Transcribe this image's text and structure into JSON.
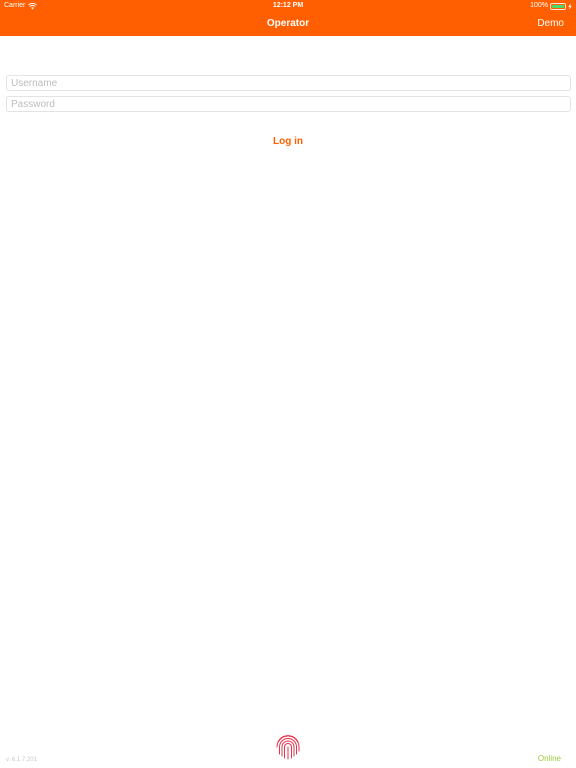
{
  "status_bar": {
    "carrier": "Carrier",
    "time": "12:12 PM",
    "battery": "100%",
    "wifi_icon": "wifi-icon",
    "battery_icon": "battery-icon",
    "charge_icon": "charging-bolt-icon"
  },
  "nav": {
    "title": "Operator",
    "demo_label": "Demo"
  },
  "form": {
    "username": {
      "value": "",
      "placeholder": "Username"
    },
    "password": {
      "value": "",
      "placeholder": "Password"
    },
    "login_label": "Log in"
  },
  "footer": {
    "version": "v. 6.1.7.201",
    "status": "Online",
    "fingerprint_icon": "fingerprint-icon"
  },
  "colors": {
    "brand": "#ff5f00",
    "header_text": "#ffffff",
    "battery_fill": "#4cd964",
    "fingerprint": "#e8334a",
    "online": "#9ccc3c",
    "placeholder": "#bdbdbd"
  }
}
